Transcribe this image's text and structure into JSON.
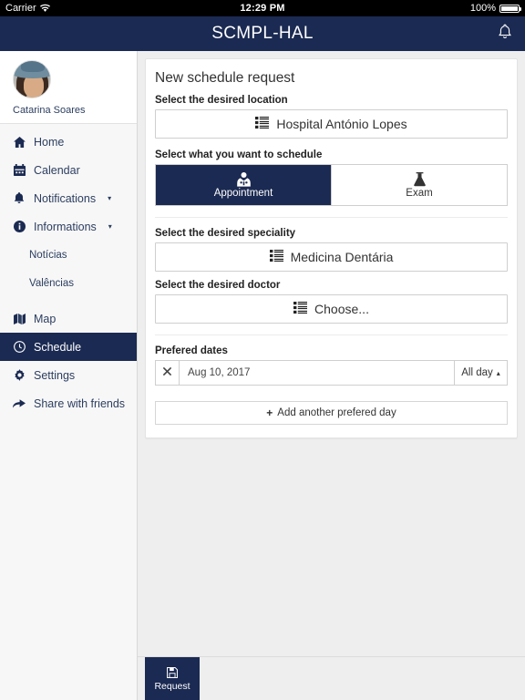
{
  "status_bar": {
    "carrier": "Carrier",
    "wifi_icon": "wifi-icon",
    "time": "12:29 PM",
    "battery_percent": "100%",
    "battery_icon": "battery-full-icon"
  },
  "navbar": {
    "title": "SCMPL-HAL",
    "bell_icon": "bell-icon"
  },
  "sidebar": {
    "profile": {
      "avatar_icon": "user-avatar",
      "name": "Catarina Soares"
    },
    "items": [
      {
        "label": "Home",
        "icon": "home-icon",
        "type": "item",
        "active": false,
        "caret": ""
      },
      {
        "label": "Calendar",
        "icon": "calendar-icon",
        "type": "item",
        "active": false,
        "caret": ""
      },
      {
        "label": "Notifications",
        "icon": "bell-icon",
        "type": "item",
        "active": false,
        "caret": "▾"
      },
      {
        "label": "Informations",
        "icon": "info-circle-icon",
        "type": "item",
        "active": false,
        "caret": "▾"
      },
      {
        "label": "Notícias",
        "icon": "",
        "type": "sub",
        "active": false,
        "caret": ""
      },
      {
        "label": "Valências",
        "icon": "",
        "type": "sub",
        "active": false,
        "caret": ""
      },
      {
        "label": "Map",
        "icon": "map-icon",
        "type": "item",
        "active": false,
        "caret": ""
      },
      {
        "label": "Schedule",
        "icon": "clock-icon",
        "type": "item",
        "active": true,
        "caret": ""
      },
      {
        "label": "Settings",
        "icon": "gear-icon",
        "type": "item",
        "active": false,
        "caret": ""
      },
      {
        "label": "Share with friends",
        "icon": "share-icon",
        "type": "item",
        "active": false,
        "caret": ""
      }
    ]
  },
  "form": {
    "title": "New schedule request",
    "location": {
      "label": "Select the desired location",
      "icon": "list-icon",
      "value": "Hospital António Lopes"
    },
    "type": {
      "label": "Select what you want to schedule",
      "options": [
        {
          "label": "Appointment",
          "icon": "doctor-icon",
          "selected": true
        },
        {
          "label": "Exam",
          "icon": "flask-icon",
          "selected": false
        }
      ]
    },
    "speciality": {
      "label": "Select the desired speciality",
      "icon": "list-icon",
      "value": "Medicina Dentária"
    },
    "doctor": {
      "label": "Select the desired doctor",
      "icon": "list-icon",
      "value": "Choose..."
    },
    "dates": {
      "label": "Prefered dates",
      "rows": [
        {
          "remove_icon": "close-x-icon",
          "value": "Aug 10, 2017",
          "placeholder": "Aug 10, 2017",
          "period_label": "All day",
          "period_caret": "▴"
        }
      ],
      "add_label": "Add another prefered day",
      "add_icon": "plus-icon"
    }
  },
  "footer": {
    "request_label": "Request",
    "request_icon": "save-icon"
  },
  "colors": {
    "navy": "#1b2a52",
    "page_bg": "#eeeeee",
    "sidebar_bg": "#f7f7f7",
    "card_bg": "#ffffff",
    "text_navy": "#2c3e60"
  }
}
